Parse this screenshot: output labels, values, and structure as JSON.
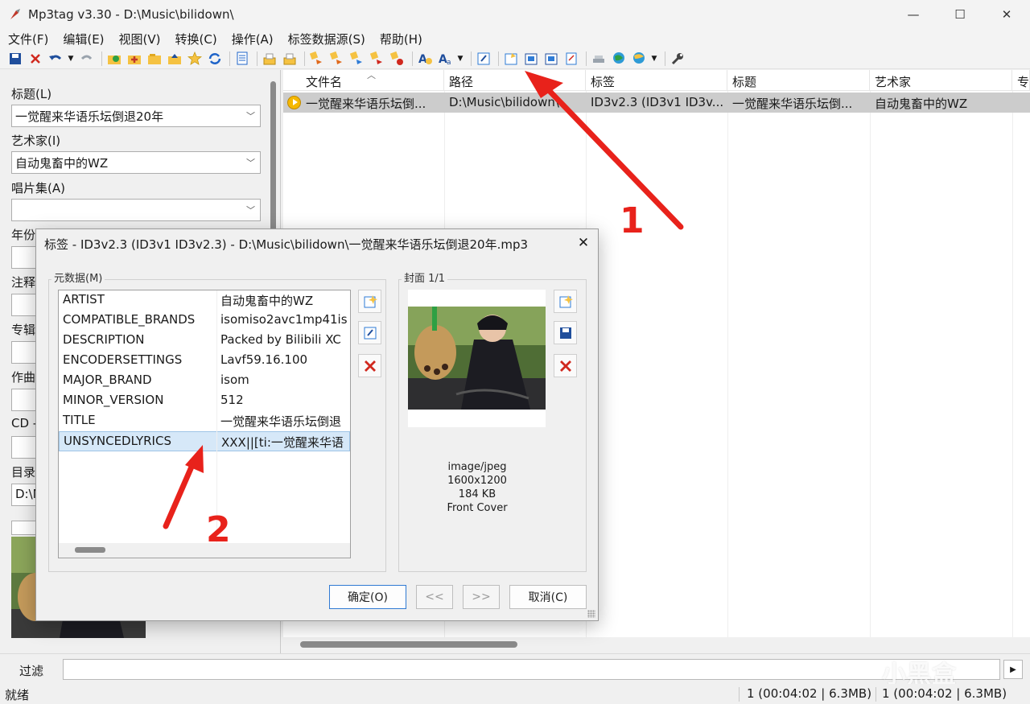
{
  "window": {
    "title": "Mp3tag v3.30  -  D:\\Music\\bilidown\\",
    "minimize": "—",
    "maximize": "☐",
    "close": "✕"
  },
  "menu": [
    "文件(F)",
    "编辑(E)",
    "视图(V)",
    "转换(C)",
    "操作(A)",
    "标签数据源(S)",
    "帮助(H)"
  ],
  "toolbar_icons": [
    "save-icon",
    "remove-tag-icon",
    "undo-icon",
    "redo-icon",
    "favorites-icon",
    "add-directory-icon",
    "open-folder-icon",
    "refresh-icon",
    "playlist-icon",
    "extended-tags-icon",
    "options-icon"
  ],
  "left_panel": {
    "title_label": "标题(L)",
    "title_value": "一觉醒来华语乐坛倒退20年",
    "artist_label": "艺术家(I)",
    "artist_value": "自动鬼畜中的WZ",
    "album_label": "唱片集(A)",
    "album_value": "",
    "year_label": "年份",
    "comment_label": "注释",
    "album_artist_label": "专辑",
    "composer_label": "作曲",
    "cd_label": "CD -",
    "directory_label": "目录",
    "directory_value": "D:\\Music\\bilidown\\"
  },
  "filelist": {
    "columns": [
      "文件名",
      "路径",
      "标签",
      "标题",
      "艺术家",
      "专"
    ],
    "rows": [
      {
        "filename": "一觉醒来华语乐坛倒...",
        "path": "D:\\Music\\bilidown\\",
        "tag": "ID3v2.3 (ID3v1 ID3v...",
        "title": "一觉醒来华语乐坛倒...",
        "artist": "自动鬼畜中的WZ"
      }
    ]
  },
  "filter": {
    "label": "过滤",
    "value": ""
  },
  "status": {
    "left": "就绪",
    "selected": "1 (00:04:02 | 6.3MB)",
    "total": "1 (00:04:02 | 6.3MB)"
  },
  "watermark": "小黑盒",
  "dialog": {
    "title": "标签 - ID3v2.3 (ID3v1 ID3v2.3) - D:\\Music\\bilidown\\一觉醒来华语乐坛倒退20年.mp3",
    "close": "✕",
    "metadata_label": "元数据(M)",
    "cover_label": "封面 1/1",
    "metadata": [
      {
        "key": "ARTIST",
        "value": "自动鬼畜中的WZ"
      },
      {
        "key": "COMPATIBLE_BRANDS",
        "value": "isomiso2avc1mp41is"
      },
      {
        "key": "DESCRIPTION",
        "value": "Packed by Bilibili XC"
      },
      {
        "key": "ENCODERSETTINGS",
        "value": "Lavf59.16.100"
      },
      {
        "key": "MAJOR_BRAND",
        "value": "isom"
      },
      {
        "key": "MINOR_VERSION",
        "value": "512"
      },
      {
        "key": "TITLE",
        "value": "一觉醒来华语乐坛倒退"
      },
      {
        "key": "UNSYNCEDLYRICS",
        "value": "XXX||[ti:一觉醒来华语"
      }
    ],
    "selected_row": "UNSYNCEDLYRICS",
    "cover_info": {
      "mime": "image/jpeg",
      "dimensions": "1600x1200",
      "size": "184 KB",
      "type": "Front Cover"
    },
    "buttons": {
      "ok": "确定(O)",
      "prev": "<<",
      "next": ">>",
      "cancel": "取消(C)"
    }
  },
  "annotations": {
    "one": "1",
    "two": "2"
  },
  "colors": {
    "selection": "#cccccc",
    "dialog_selection": "#d6e8f8",
    "annotation_red": "#e8221b",
    "primary_border": "#2f7ad3"
  }
}
